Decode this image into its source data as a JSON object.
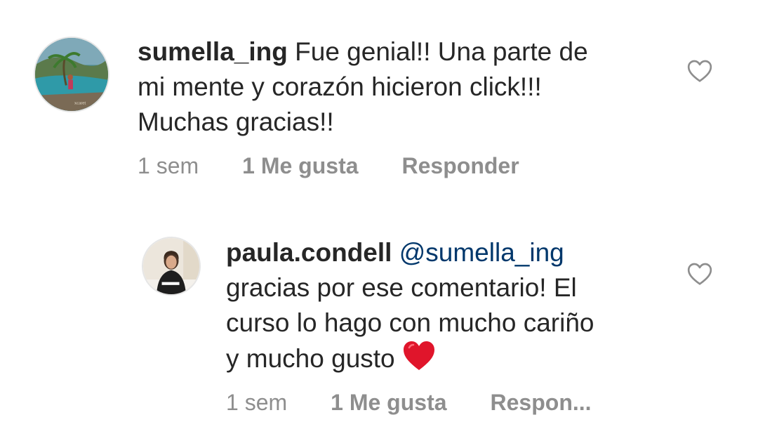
{
  "comments": [
    {
      "username": "sumella_ing",
      "text_lines": [
        "Fue genial!! Una parte de",
        "mi mente y corazón hicieron click!!!",
        "Muchas gracias!!"
      ],
      "time": "1 sem",
      "likes": "1 Me gusta",
      "reply": "Responder",
      "avatar_icon": "beach-photo-avatar"
    },
    {
      "username": "paula.condell",
      "mention": "@sumella_ing",
      "text_lines": [
        "gracias por ese comentario! El",
        "curso lo hago con mucho cariño",
        "y mucho gusto"
      ],
      "emoji": "red-heart",
      "time": "1 sem",
      "likes": "1 Me gusta",
      "reply": "Respon...",
      "avatar_icon": "woman-at-desk-avatar"
    }
  ],
  "colors": {
    "text": "#262626",
    "meta": "#8e8e8e",
    "mention": "#00376b",
    "heart": "#e0152b"
  }
}
